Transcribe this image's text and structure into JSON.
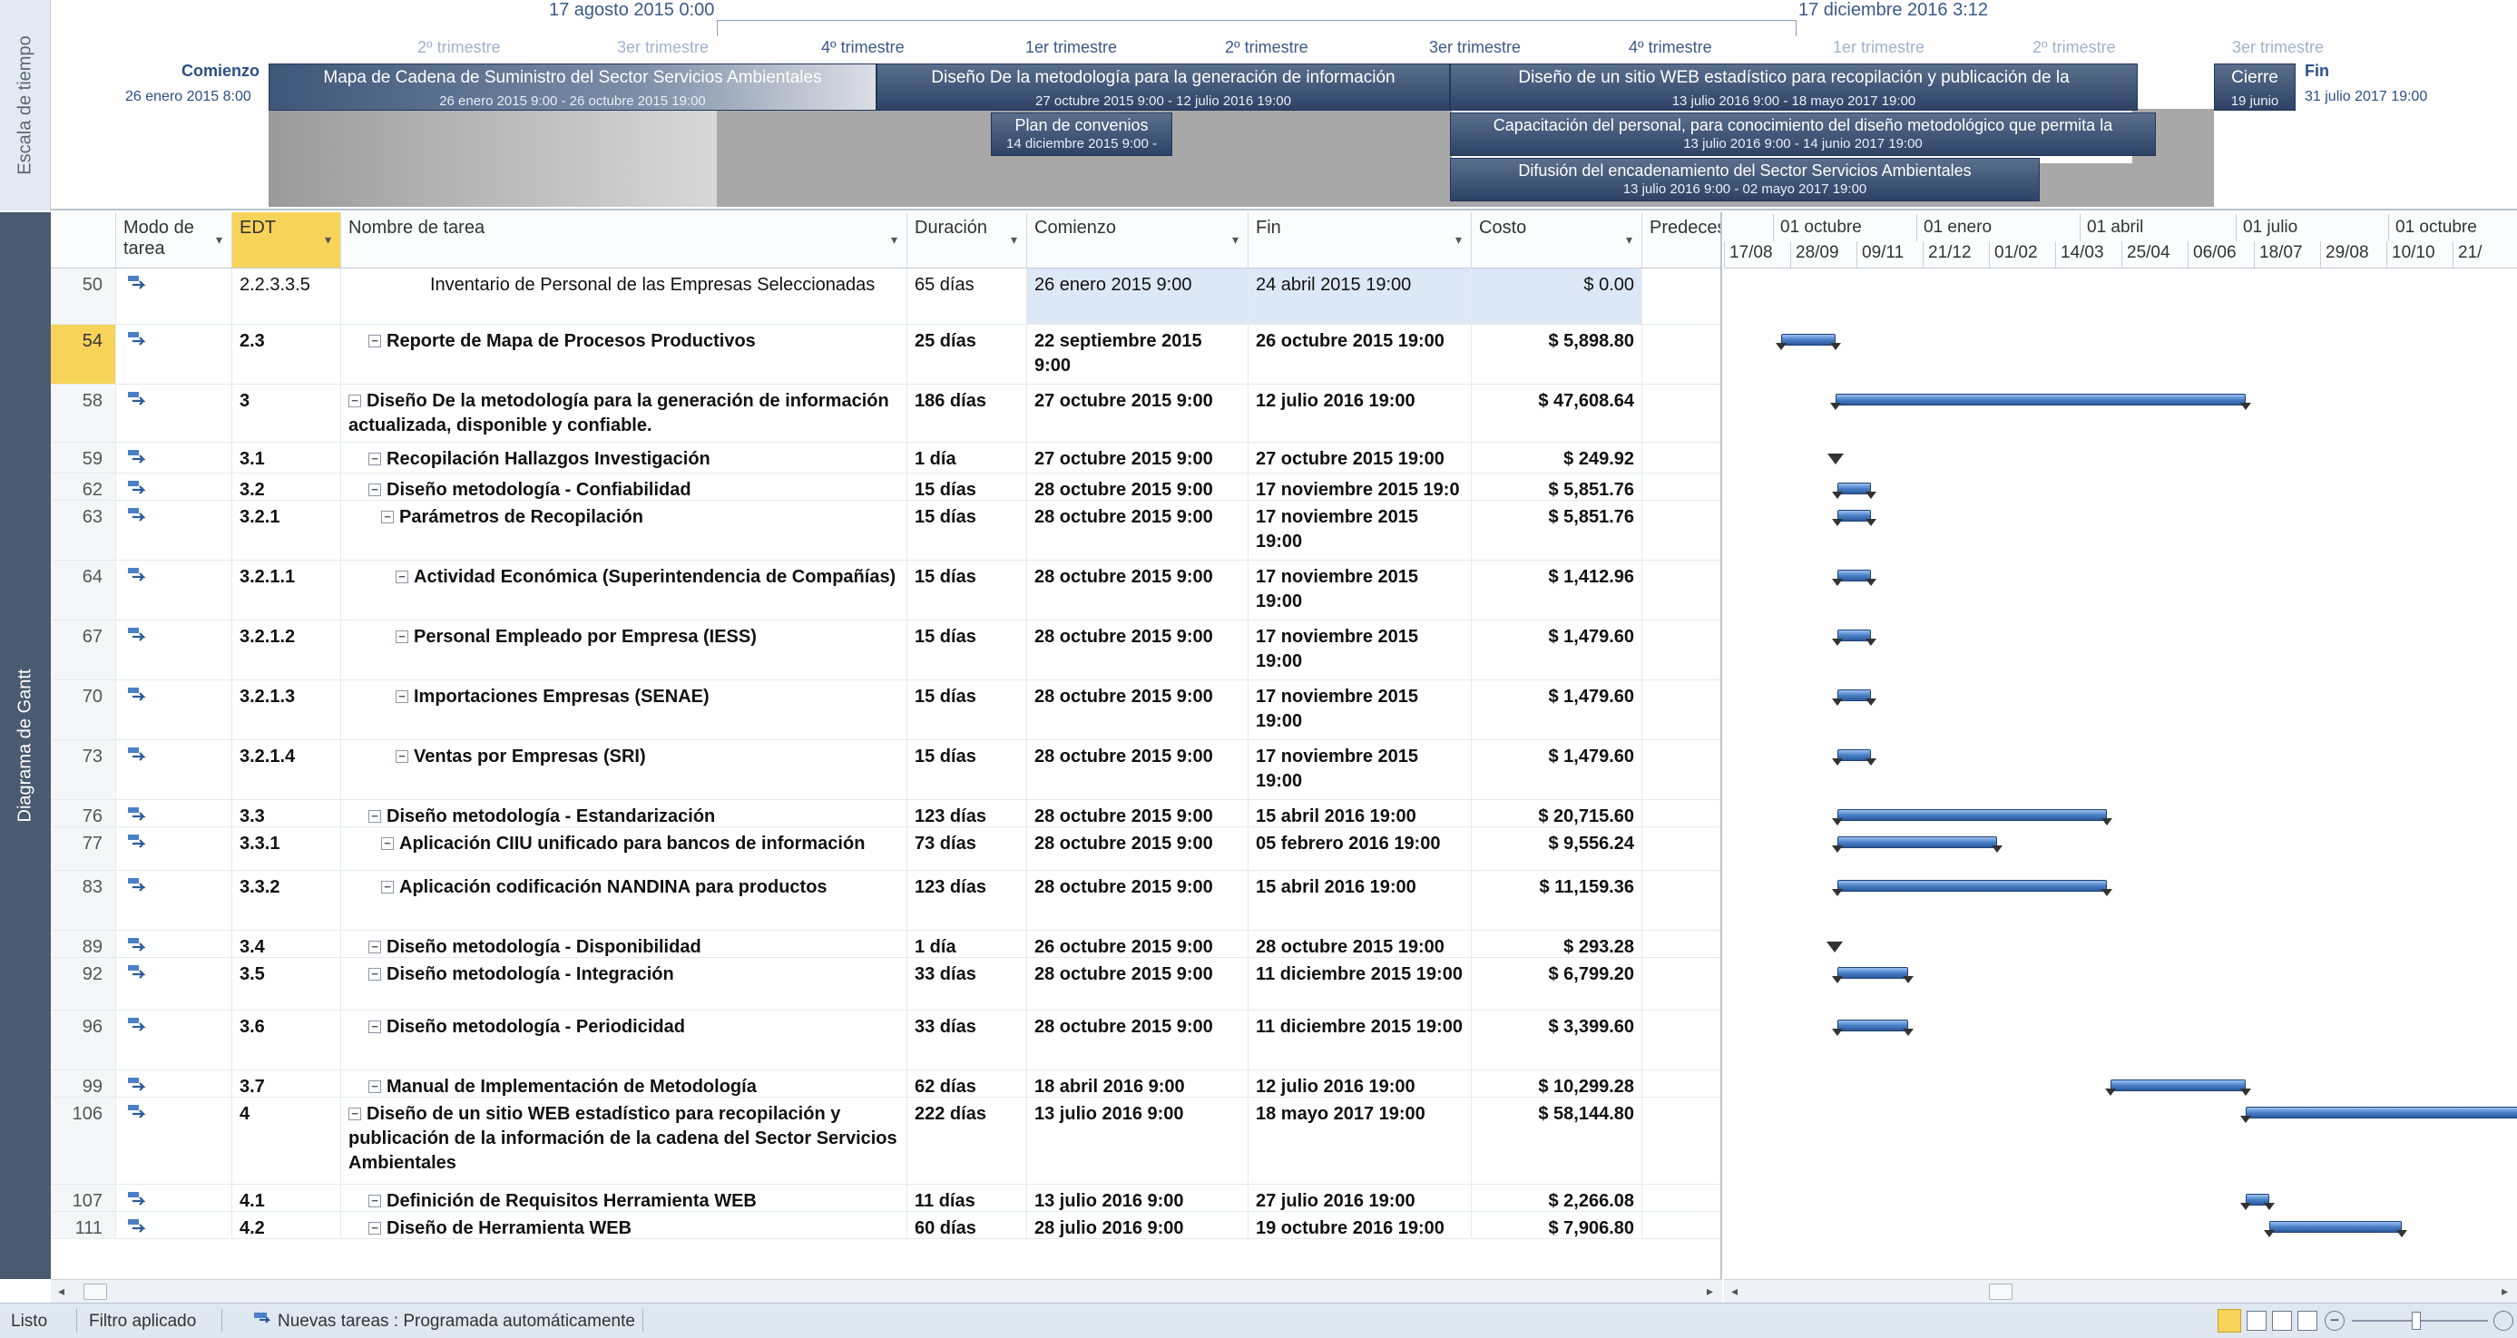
{
  "timeline": {
    "label": "Escala de tiempo",
    "view_start": "17 agosto 2015 0:00",
    "view_end": "17 diciembre 2016 3:12",
    "quarters": [
      "2º trimestre",
      "3er trimestre",
      "4º trimestre",
      "1er trimestre",
      "2º trimestre",
      "3er trimestre",
      "4º trimestre",
      "1er trimestre",
      "2º trimestre",
      "3er trimestre"
    ],
    "start_label": "Comienzo",
    "start_date": "26 enero 2015 8:00",
    "end_label": "Fin",
    "end_date": "31 julio 2017 19:00",
    "bars": [
      {
        "title": "Mapa de Cadena de Suministro del Sector Servicios Ambientales",
        "dates": "26 enero 2015 9:00 - 26 octubre 2015 19:00"
      },
      {
        "title": "Diseño De la metodología para la generación de información",
        "dates": "27 octubre 2015 9:00 - 12 julio 2016 19:00"
      },
      {
        "title": "Diseño de un sitio WEB estadístico para recopilación y publicación de la",
        "dates": "13 julio 2016 9:00 - 18 mayo 2017 19:00"
      },
      {
        "title": "Cierre",
        "dates": "19 junio"
      },
      {
        "title": "Plan de convenios",
        "dates": "14 diciembre 2015 9:00 -"
      },
      {
        "title": "Capacitación del personal, para conocimiento del diseño metodológico que permita la",
        "dates": "13 julio 2016 9:00 - 14 junio 2017 19:00"
      },
      {
        "title": "Difusión del encadenamiento del Sector Servicios Ambientales",
        "dates": "13 julio 2016 9:00 - 02 mayo 2017 19:00"
      }
    ]
  },
  "gantt_label": "Diagrama de Gantt",
  "columns": {
    "mode": "Modo de tarea",
    "edt": "EDT",
    "name": "Nombre de tarea",
    "duration": "Duración",
    "start": "Comienzo",
    "finish": "Fin",
    "cost": "Costo",
    "pred": "Predeces"
  },
  "chart_header": {
    "top": [
      "01 octubre",
      "01 enero",
      "01 abril",
      "01 julio",
      "01 octubre"
    ],
    "bottom": [
      "17/08",
      "28/09",
      "09/11",
      "21/12",
      "01/02",
      "14/03",
      "25/04",
      "06/06",
      "18/07",
      "29/08",
      "10/10",
      "21/"
    ]
  },
  "rows": [
    {
      "id": "50",
      "edt": "2.2.3.3.5",
      "name": "Inventario de Personal de las Empresas Seleccionadas",
      "duration": "65 días",
      "start": "26 enero 2015 9:00",
      "finish": "24 abril 2015 19:00",
      "cost": "$ 0.00"
    },
    {
      "id": "54",
      "edt": "2.3",
      "name": "Reporte de Mapa de Procesos Productivos",
      "duration": "25 días",
      "start": "22 septiembre 2015 9:00",
      "finish": "26 octubre 2015 19:00",
      "cost": "$ 5,898.80"
    },
    {
      "id": "58",
      "edt": "3",
      "name": "Diseño De la metodología para la generación de información actualizada, disponible y confiable.",
      "duration": "186 días",
      "start": "27 octubre 2015 9:00",
      "finish": "12 julio 2016 19:00",
      "cost": "$ 47,608.64"
    },
    {
      "id": "59",
      "edt": "3.1",
      "name": "Recopilación Hallazgos Investigación",
      "duration": "1 día",
      "start": "27 octubre 2015 9:00",
      "finish": "27 octubre 2015 19:00",
      "cost": "$ 249.92"
    },
    {
      "id": "62",
      "edt": "3.2",
      "name": "Diseño metodología - Confiabilidad",
      "duration": "15 días",
      "start": "28 octubre 2015 9:00",
      "finish": "17 noviembre 2015 19:0",
      "cost": "$ 5,851.76"
    },
    {
      "id": "63",
      "edt": "3.2.1",
      "name": "Parámetros de Recopilación",
      "duration": "15 días",
      "start": "28 octubre 2015 9:00",
      "finish": "17 noviembre 2015 19:00",
      "cost": "$ 5,851.76"
    },
    {
      "id": "64",
      "edt": "3.2.1.1",
      "name": "Actividad Económica (Superintendencia de Compañías)",
      "duration": "15 días",
      "start": "28 octubre 2015 9:00",
      "finish": "17 noviembre 2015 19:00",
      "cost": "$ 1,412.96"
    },
    {
      "id": "67",
      "edt": "3.2.1.2",
      "name": "Personal Empleado por Empresa (IESS)",
      "duration": "15 días",
      "start": "28 octubre 2015 9:00",
      "finish": "17 noviembre 2015 19:00",
      "cost": "$ 1,479.60"
    },
    {
      "id": "70",
      "edt": "3.2.1.3",
      "name": "Importaciones Empresas (SENAE)",
      "duration": "15 días",
      "start": "28 octubre 2015 9:00",
      "finish": "17 noviembre 2015 19:00",
      "cost": "$ 1,479.60"
    },
    {
      "id": "73",
      "edt": "3.2.1.4",
      "name": "Ventas por Empresas (SRI)",
      "duration": "15 días",
      "start": "28 octubre 2015 9:00",
      "finish": "17 noviembre 2015 19:00",
      "cost": "$ 1,479.60"
    },
    {
      "id": "76",
      "edt": "3.3",
      "name": "Diseño metodología - Estandarización",
      "duration": "123 días",
      "start": "28 octubre 2015 9:00",
      "finish": "15 abril 2016 19:00",
      "cost": "$ 20,715.60"
    },
    {
      "id": "77",
      "edt": "3.3.1",
      "name": "Aplicación CIIU unificado para bancos de información",
      "duration": "73 días",
      "start": "28 octubre 2015 9:00",
      "finish": "05 febrero 2016 19:00",
      "cost": "$ 9,556.24"
    },
    {
      "id": "83",
      "edt": "3.3.2",
      "name": "Aplicación codificación NANDINA para productos",
      "duration": "123 días",
      "start": "28 octubre 2015 9:00",
      "finish": "15 abril 2016 19:00",
      "cost": "$ 11,159.36"
    },
    {
      "id": "89",
      "edt": "3.4",
      "name": "Diseño metodología - Disponibilidad",
      "duration": "1 día",
      "start": "26 octubre 2015 9:00",
      "finish": "28 octubre 2015 19:00",
      "cost": "$ 293.28"
    },
    {
      "id": "92",
      "edt": "3.5",
      "name": "Diseño metodología - Integración",
      "duration": "33 días",
      "start": "28 octubre 2015 9:00",
      "finish": "11 diciembre 2015 19:00",
      "cost": "$ 6,799.20"
    },
    {
      "id": "96",
      "edt": "3.6",
      "name": "Diseño metodología - Periodicidad",
      "duration": "33 días",
      "start": "28 octubre 2015 9:00",
      "finish": "11 diciembre 2015 19:00",
      "cost": "$ 3,399.60"
    },
    {
      "id": "99",
      "edt": "3.7",
      "name": "Manual de Implementación de Metodología",
      "duration": "62 días",
      "start": "18 abril 2016 9:00",
      "finish": "12 julio 2016 19:00",
      "cost": "$ 10,299.28"
    },
    {
      "id": "106",
      "edt": "4",
      "name": "Diseño de un sitio WEB estadístico para recopilación y publicación de la información de la cadena del Sector Servicios Ambientales",
      "duration": "222 días",
      "start": "13 julio 2016 9:00",
      "finish": "18 mayo 2017 19:00",
      "cost": "$ 58,144.80"
    },
    {
      "id": "107",
      "edt": "4.1",
      "name": "Definición de Requisitos Herramienta WEB",
      "duration": "11 días",
      "start": "13 julio 2016 9:00",
      "finish": "27 julio 2016 19:00",
      "cost": "$ 2,266.08"
    },
    {
      "id": "111",
      "edt": "4.2",
      "name": "Diseño de Herramienta WEB",
      "duration": "60 días",
      "start": "28 julio 2016 9:00",
      "finish": "19 octubre 2016 19:00",
      "cost": "$ 7,906.80"
    }
  ],
  "status": {
    "ready": "Listo",
    "filter": "Filtro aplicado",
    "new_tasks": "Nuevas tareas : Programada automáticamente"
  }
}
